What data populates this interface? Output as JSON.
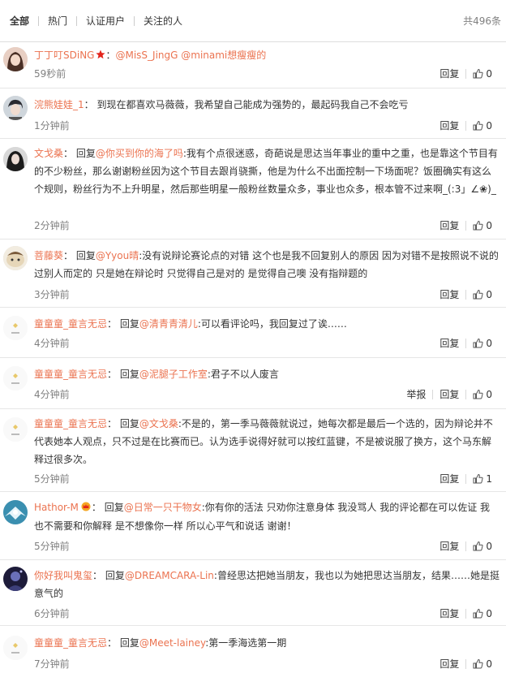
{
  "tabs": {
    "items": [
      "全部",
      "热门",
      "认证用户",
      "关注的人"
    ],
    "count_text": "共496条"
  },
  "actions": {
    "reply": "回复",
    "report": "举报"
  },
  "colors": {
    "link": "#eb7350",
    "meta": "#808080",
    "text": "#333333"
  },
  "comments": [
    {
      "user": "丁丁叮SDiNG",
      "badge": "star",
      "text_before": "：",
      "mention": "@MisS_JingG @minami想瘦瘦的",
      "text_after": "",
      "time": "59秒前",
      "likes": "0"
    },
    {
      "user": "浣熊娃娃_1",
      "badge": "",
      "text_before": "： 到现在都喜欢马薇薇，我希望自己能成为强势的，最起码我自己不会吃亏",
      "mention": "",
      "text_after": "",
      "time": "1分钟前",
      "likes": "0"
    },
    {
      "user": "文戈桑",
      "badge": "",
      "text_before": "： 回复",
      "mention": "@你买到你的海了吗",
      "text_after": ":我有个点很迷惑，奇葩说是思达当年事业的重中之重，也是靠这个节目有的不少粉丝，那么谢谢粉丝因为这个节目去跟肖骁撕，他是为什么不出面控制一下场面呢？饭圈确实有这么个规则，粉丝行为不上升明星，然后那些明星一般粉丝数量众多，事业也众多，根本管不过来啊_(:3」∠❀)_",
      "time": "2分钟前",
      "likes": "0"
    },
    {
      "user": "菩藤葵",
      "badge": "",
      "text_before": "： 回复",
      "mention": "@Yyou晴",
      "text_after": ":没有说辩论赛论点的对错 这个也是我不回复别人的原因 因为对错不是按照说不说的过别人而定的 只是她在辩论时 只觉得自己是对的 是觉得自己噢 没有指辩题的",
      "time": "3分钟前",
      "likes": "0"
    },
    {
      "user": "童童童_童言无忌",
      "badge": "",
      "text_before": "： 回复",
      "mention": "@清青青清儿",
      "text_after": ":可以看评论吗，我回复过了诶……",
      "time": "4分钟前",
      "likes": "0"
    },
    {
      "user": "童童童_童言无忌",
      "badge": "",
      "text_before": "： 回复",
      "mention": "@泥腿子工作室",
      "text_after": ":君子不以人废言",
      "time": "4分钟前",
      "likes": "0",
      "report": true
    },
    {
      "user": "童童童_童言无忌",
      "badge": "",
      "text_before": "： 回复",
      "mention": "@文戈桑",
      "text_after": ":不是的，第一季马薇薇就说过，她每次都是最后一个选的，因为辩论并不代表她本人观点，只不过是在比赛而已。认为选手说得好就可以按红蓝键，不是被说服了换方，这个马东解释过很多次。",
      "time": "5分钟前",
      "likes": "1"
    },
    {
      "user": "Hathor-M",
      "badge": "crown",
      "text_before": "： 回复",
      "mention": "@日常一只干物女",
      "text_after": ":你有你的活法 只劝你注意身体 我没骂人 我的评论都在可以佐证 我也不需要和你解释 是不想像你一样 所以心平气和说话 谢谢！",
      "time": "5分钟前",
      "likes": "0"
    },
    {
      "user": "你好我叫鬼玺",
      "badge": "",
      "text_before": "： 回复",
      "mention": "@DREAMCARA-Lin",
      "text_after": ":曾经思达把她当朋友，我也以为她把思达当朋友，结果……她是挺意气的",
      "time": "6分钟前",
      "likes": "0"
    },
    {
      "user": "童童童_童言无忌",
      "badge": "",
      "text_before": "： 回复",
      "mention": "@Meet-lainey",
      "text_after": ":第一季海选第一期",
      "time": "7分钟前",
      "likes": "0"
    }
  ]
}
